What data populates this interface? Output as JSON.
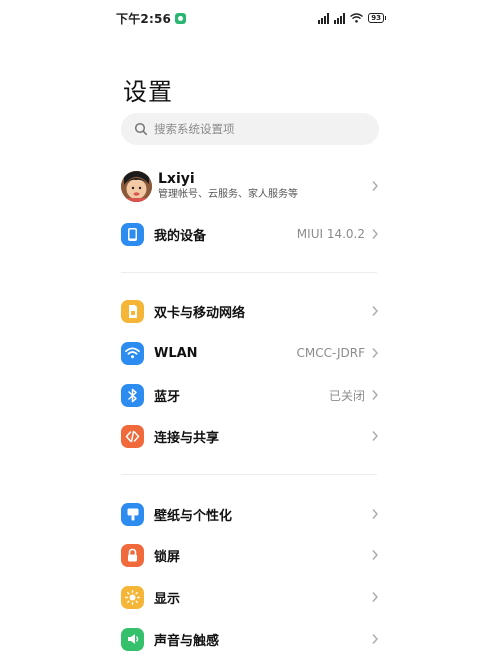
{
  "status_bar": {
    "time": "下午2:56",
    "battery": "93"
  },
  "header": {
    "title": "设置"
  },
  "search": {
    "placeholder": "搜索系统设置项"
  },
  "account": {
    "name": "Lxiyi",
    "subtitle": "管理帐号、云服务、家人服务等"
  },
  "device": {
    "label": "我的设备",
    "value": "MIUI 14.0.2"
  },
  "network_items": [
    {
      "label": "双卡与移动网络",
      "value": "",
      "icon": "sim-card-icon",
      "color": "#f5b638"
    },
    {
      "label": "WLAN",
      "value": "CMCC-JDRF",
      "icon": "wifi-icon",
      "color": "#2d8cf0"
    },
    {
      "label": "蓝牙",
      "value": "已关闭",
      "icon": "bluetooth-icon",
      "color": "#2d8cf0"
    },
    {
      "label": "连接与共享",
      "value": "",
      "icon": "connection-share-icon",
      "color": "#f06a3c"
    }
  ],
  "personal_items": [
    {
      "label": "壁纸与个性化",
      "value": "",
      "icon": "wallpaper-icon",
      "color": "#2d8cf0"
    },
    {
      "label": "锁屏",
      "value": "",
      "icon": "lock-icon",
      "color": "#f06a3c"
    },
    {
      "label": "显示",
      "value": "",
      "icon": "sun-icon",
      "color": "#f5b638"
    },
    {
      "label": "声音与触感",
      "value": "",
      "icon": "speaker-icon",
      "color": "#35c06b"
    }
  ],
  "colors": {
    "accent_blue": "#2d8cf0",
    "yellow": "#f5b638",
    "orange": "#f06a3c",
    "green": "#35c06b"
  }
}
